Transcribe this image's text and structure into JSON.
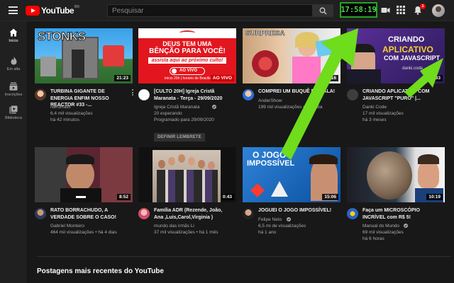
{
  "header": {
    "logo_text": "YouTube",
    "logo_region": "BR",
    "search_placeholder": "Pesquisar",
    "clock": "17:58:19",
    "notification_count": "1"
  },
  "sidebar": {
    "items": [
      {
        "label": "Início"
      },
      {
        "label": "Em alta"
      },
      {
        "label": "Inscrições"
      },
      {
        "label": "Biblioteca"
      }
    ]
  },
  "videos": [
    {
      "thumb_text": "STONKS",
      "duration": "21:23",
      "title": "TURBINA GIGANTE DE ENERGIA ENFIM NOSSO REACTOR #33 -...",
      "channel": "NerdRalls",
      "views": "6,4 mil visualizações",
      "age": "há 42 minutos"
    },
    {
      "thumb_text_1": "DEUS TEM UMA",
      "thumb_text_2": "BÊNÇÃO PARA VOCÊ!",
      "thumb_text_3": "assista aqui ao próximo culto!",
      "thumb_text_4": "AO VIVO",
      "thumb_text_5": "início 20h | horário de Brasília",
      "duration": "AO VIVO",
      "title": "[CULTO 20H] Igreja Cristã Maranata - Terça - 29/09/2020",
      "channel": "Igreja Cristã Maranata",
      "views": "20 esperando",
      "age": "Programado para 29/09/2020",
      "button": "DEFINIR LEMBRETE"
    },
    {
      "thumb_text": "SURPRESA",
      "duration": "8:16",
      "title": "COMPREI UM BUQUÊ DE BALA!",
      "channel": "AnderShow",
      "views": "199 mil visualizações",
      "age": "há 1 dia"
    },
    {
      "thumb_text_1": "CRIANDO",
      "thumb_text_2": "APLICATIVO",
      "thumb_text_3": "COM JAVASCRIPT",
      "thumb_text_4": "danki.code",
      "duration": "18:33",
      "title": "CRIANDO APLICATIVO COM JAVASCRIPT \"PURO\" |...",
      "channel": "Danki Code",
      "views": "17 mil visualizações",
      "age": "há 3 meses"
    },
    {
      "duration": "8:52",
      "title": "RATO BORRACHUDO, A VERDADE SOBRE O CASO!",
      "channel": "Gabriel Monteiro",
      "views": "464 mil visualizações",
      "age": "há 4 dias"
    },
    {
      "duration": "0:43",
      "title": "Família ADR (Rezende, João, Ana ,Luis,Carol,Virginia )",
      "channel": "mundo das irmãs Li",
      "views": "37 mil visualizações",
      "age": "há 1 mês"
    },
    {
      "thumb_text_1": "O JOGO",
      "thumb_text_2": "IMPOSSÍVEL",
      "duration": "15:06",
      "title": "JOGUEI O JOGO IMPOSSÍVEL!",
      "channel": "Felipe Neto",
      "views": "6,5 mi de visualizações",
      "age": "há 1 ano"
    },
    {
      "duration": "10:19",
      "title": "Faça um MICROSCÓPIO INCRÍVEL com R$ 5!",
      "channel": "Manual do Mundo",
      "views": "69 mil visualizações",
      "age": "há 6 horas"
    }
  ],
  "sections": {
    "posts_title": "Postagens mais recentes do YouTube"
  },
  "colors": {
    "background": "#181818",
    "topbar": "#202020",
    "brand_red": "#ff0000",
    "clock_green": "#4dd24d",
    "arrow_green": "#6fdc1c",
    "verified_blue": "#3ea6ff"
  }
}
